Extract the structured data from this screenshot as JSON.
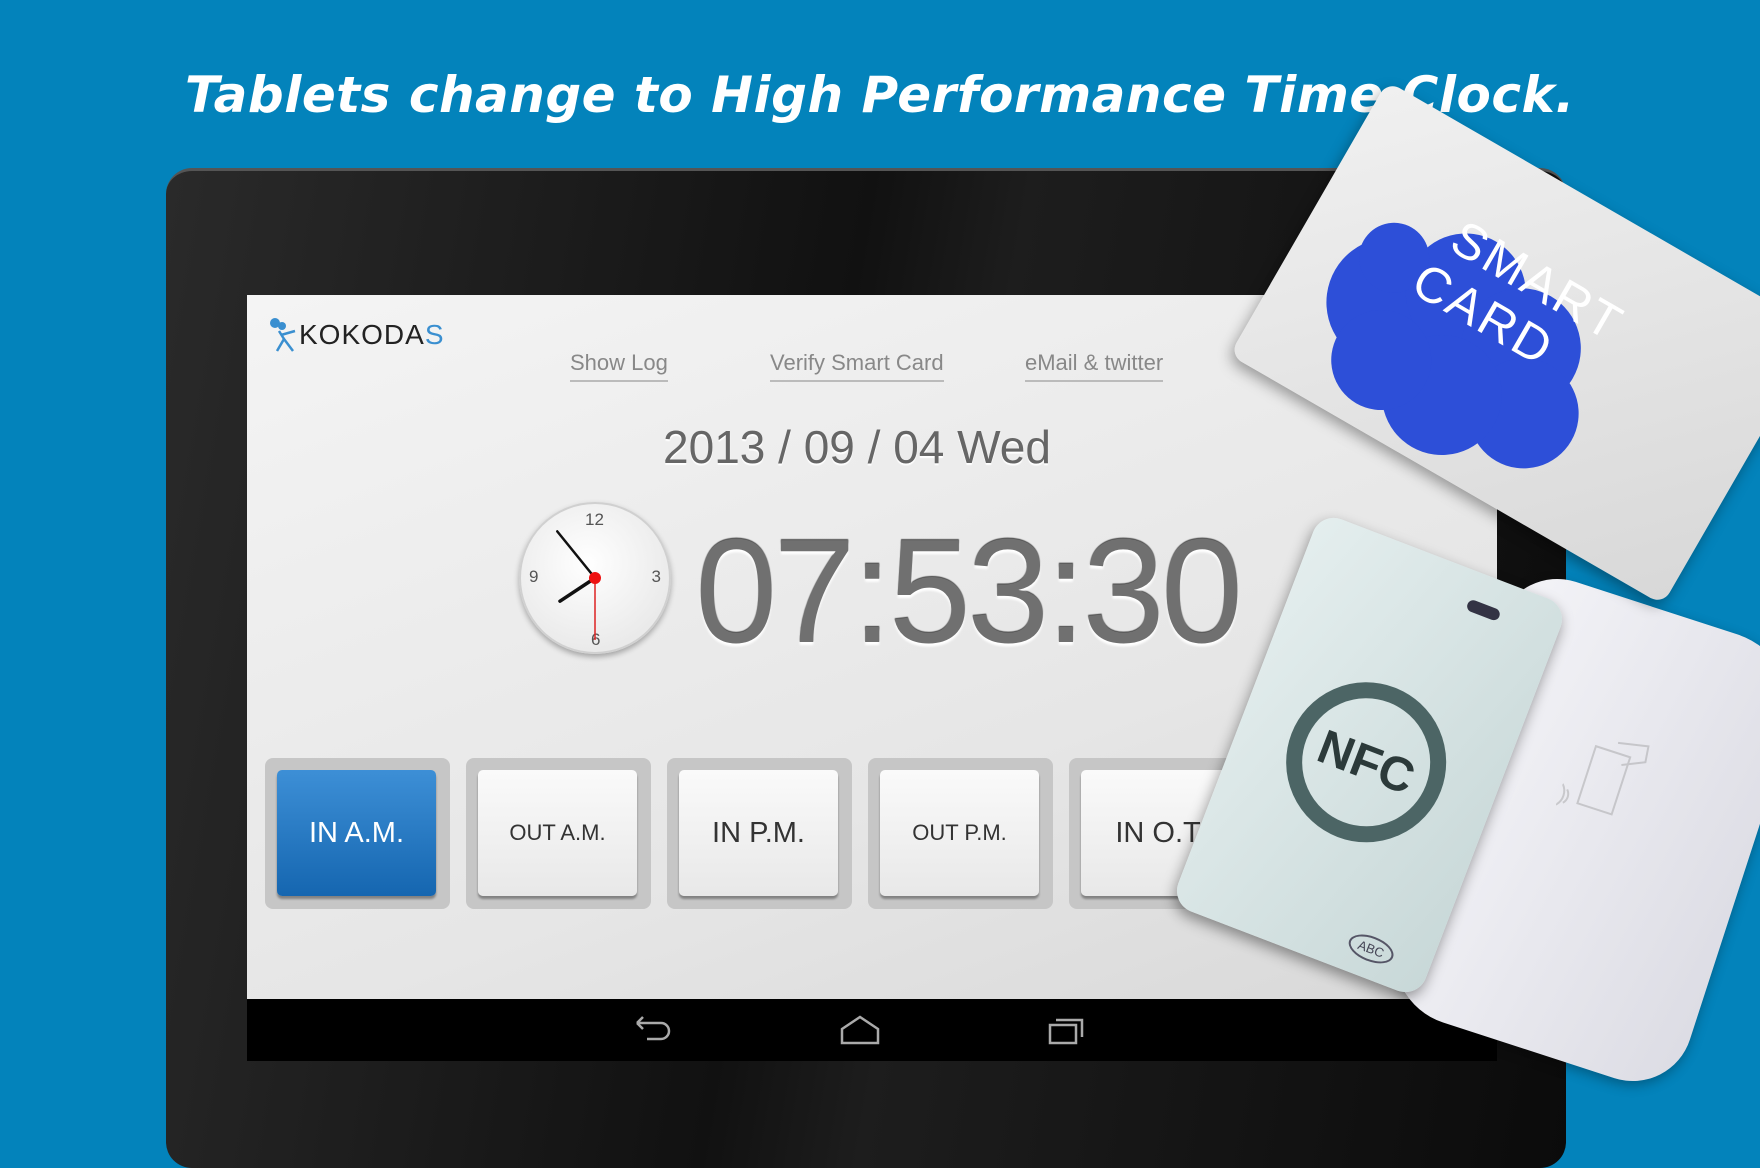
{
  "headline": "Tablets change to High Performance Time Clock.",
  "app": {
    "logo_text": "KOKODA",
    "logo_accent": "S",
    "links": [
      "Show Log",
      "Verify Smart Card",
      "eMail & twitter"
    ],
    "date": "2013 / 09 / 04 Wed",
    "time": "07:53:30",
    "analog_clock": {
      "numerals": [
        "12",
        "3",
        "6",
        "9"
      ],
      "hour": 7,
      "minute": 53,
      "second": 30
    },
    "buttons": [
      {
        "label": "IN A.M.",
        "active": true
      },
      {
        "label": "OUT A.M.",
        "active": false
      },
      {
        "label": "IN P.M.",
        "active": false
      },
      {
        "label": "OUT P.M.",
        "active": false
      },
      {
        "label": "IN O.T.",
        "active": false
      }
    ],
    "nav": [
      "back-icon",
      "home-icon",
      "recent-apps-icon"
    ]
  },
  "smart_card": {
    "text_line1": "SMART",
    "text_line2": "CARD"
  },
  "reader": {
    "nfc_label": "NFC",
    "brand": "ABC"
  },
  "colors": {
    "background": "#0383bb",
    "active_button": "#1e72bd",
    "card_cloud": "#2d4fd8"
  }
}
